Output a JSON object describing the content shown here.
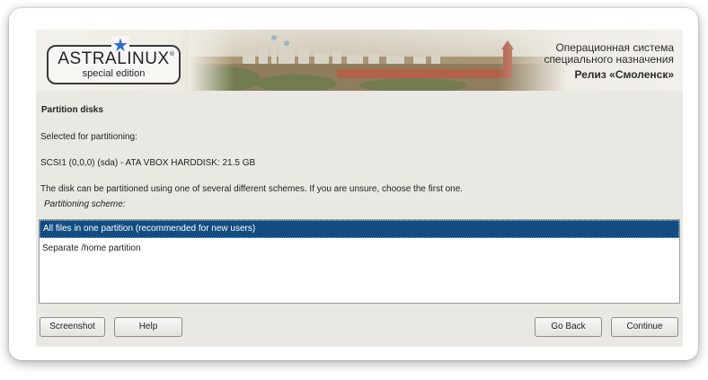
{
  "banner": {
    "logo_main": "ASTRALINUX",
    "logo_reg": "®",
    "logo_sub": "special edition",
    "star_icon": "star-icon",
    "brand_line1": "Операционная система",
    "brand_line2": "специального назначения",
    "brand_line3": "Релиз «Смоленск»"
  },
  "content": {
    "title": "Partition disks",
    "selected_label": "Selected for partitioning:",
    "disk": "SCSI1 (0,0,0) (sda) - ATA VBOX HARDDISK: 21.5 GB",
    "info": "The disk can be partitioned using one of several different schemes. If you are unsure, choose the first one.",
    "scheme_label": "Partitioning scheme:",
    "options": [
      "All files in one partition (recommended for new users)",
      "Separate /home partition"
    ],
    "selected_index": 0
  },
  "buttons": {
    "screenshot": "Screenshot",
    "help": "Help",
    "go_back": "Go Back",
    "continue": "Continue"
  },
  "colors": {
    "selection": "#124d82",
    "background": "#e9e8e3",
    "logo_star": "#2a6ecb"
  }
}
